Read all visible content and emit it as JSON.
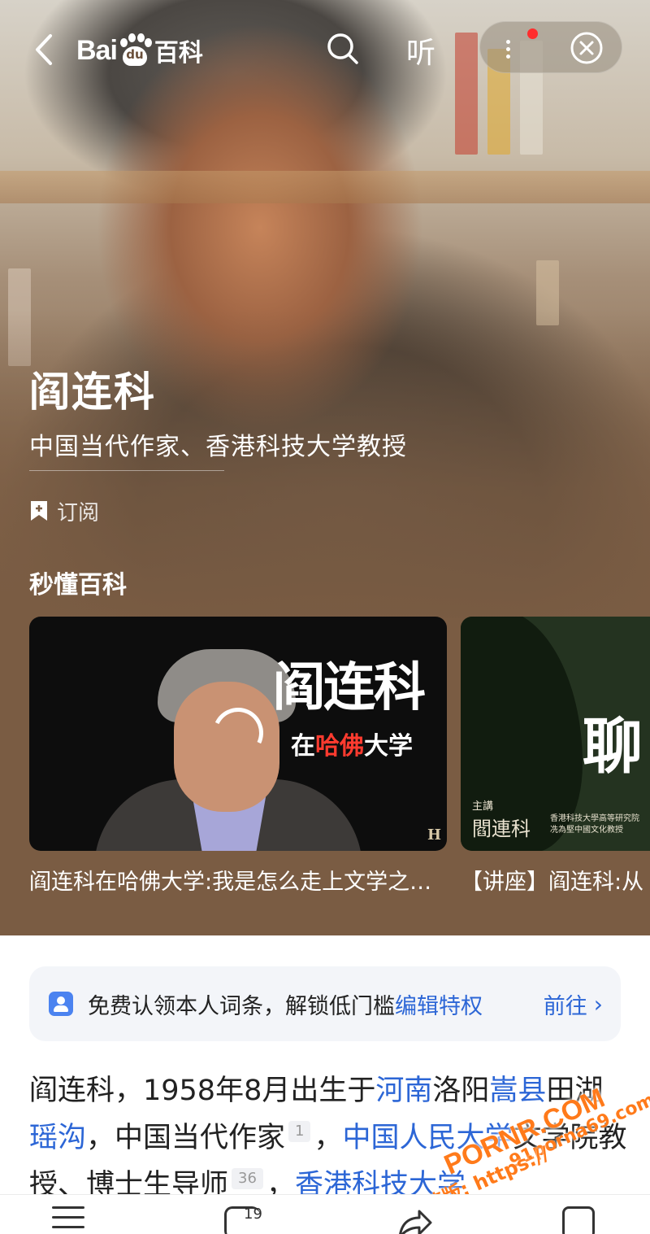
{
  "topbar": {
    "logo_bai": "Bai",
    "logo_du": "du",
    "logo_baike": "百科",
    "listen_label": "听"
  },
  "entry": {
    "title": "阎连科",
    "subtitle": "中国当代作家、香港科技大学教授",
    "subscribe_label": "订阅"
  },
  "videos": {
    "section_title": "秒懂百科",
    "items": [
      {
        "thumb_title": "阎连科",
        "thumb_sub_pre": "在",
        "thumb_sub_hl": "哈佛",
        "thumb_sub_post": "大学",
        "thumb_mark": "H",
        "caption": "阎连科在哈佛大学:我是怎么走上文学之路的"
      },
      {
        "thumb_big": "聊",
        "thumb_l1": "主講",
        "thumb_l2": "閻連科",
        "thumb_l3": "香港科技大學高等研究院 冼為堅中國文化教授",
        "caption": "【讲座】阎连科:从"
      }
    ]
  },
  "claim": {
    "text": "免费认领本人词条，解锁低门槛",
    "link_text": "编辑特权",
    "go_label": "前往"
  },
  "summary": {
    "p1": "阎连科，1958年8月出生于",
    "l1": "河南",
    "p2": "洛阳",
    "l2": "嵩县",
    "p3": "田湖",
    "l3": "瑶沟",
    "p4": "，中国当代作家",
    "ref1": "1",
    "p5": "，",
    "l4": "中国人民大学",
    "p6": "文学院教授、博士生导师",
    "ref2": "36",
    "p7": "，",
    "l5": "香港科技大学"
  },
  "watermark": {
    "w1": "PORNR.COM",
    "w2": "91porna69.com",
    "w3": "看完整版: https://"
  },
  "bottombar": {
    "comment_count": "19"
  },
  "colors": {
    "hero_bg": "#7a5c43",
    "link_blue": "#2c66d6",
    "badge_red": "#ff2d2d",
    "claim_bg": "#f3f5f9"
  }
}
